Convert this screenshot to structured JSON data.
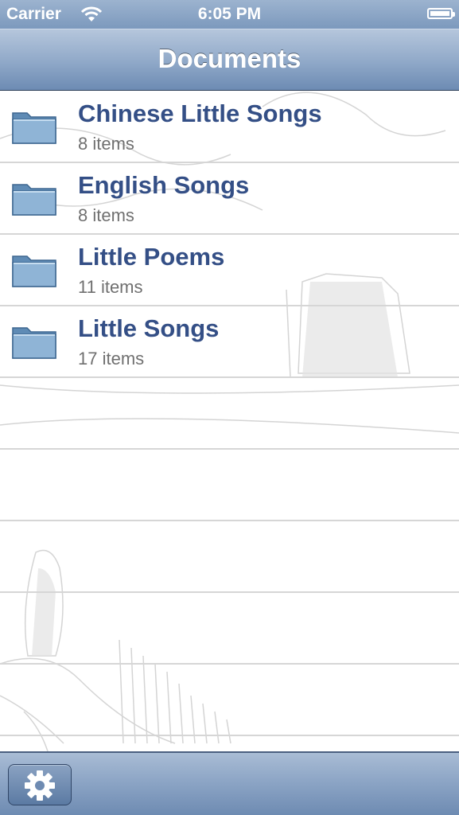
{
  "status_bar": {
    "carrier": "Carrier",
    "time": "6:05 PM"
  },
  "nav_bar": {
    "title": "Documents"
  },
  "folders": [
    {
      "name": "Chinese Little Songs",
      "count": "8 items"
    },
    {
      "name": "English Songs",
      "count": "8 items"
    },
    {
      "name": "Little Poems",
      "count": "11 items"
    },
    {
      "name": "Little Songs",
      "count": "17 items"
    }
  ],
  "toolbar": {
    "settings_icon": "gear-icon"
  },
  "colors": {
    "title_text": "#344f86",
    "subtitle_text": "#707070",
    "bar_blue": "#8fa8c8"
  }
}
